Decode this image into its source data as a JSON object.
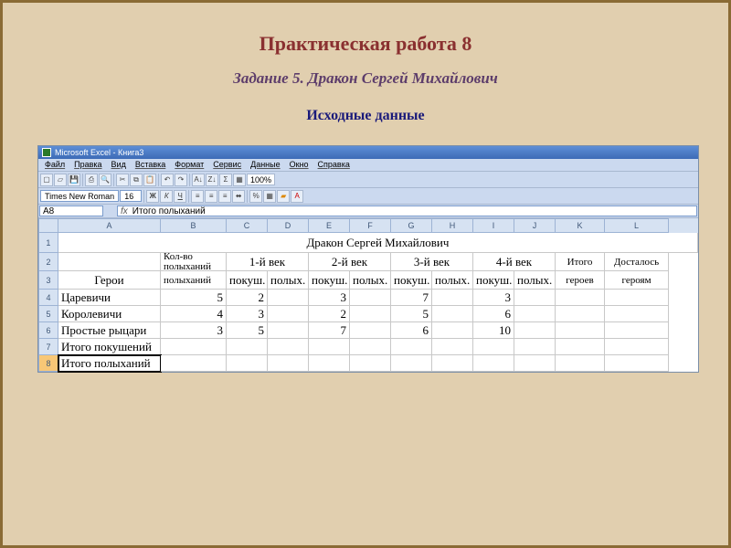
{
  "page": {
    "title_main": "Практическая работа 8",
    "title_task": "Задание 5. Дракон Сергей Михайлович",
    "title_data": "Исходные данные"
  },
  "excel": {
    "app_title": "Microsoft Excel - Книга3",
    "menus": [
      "Файл",
      "Правка",
      "Вид",
      "Вставка",
      "Формат",
      "Сервис",
      "Данные",
      "Окно",
      "Справка"
    ],
    "font_name": "Times New Roman",
    "font_size": "16",
    "zoom": "100%",
    "name_box": "A8",
    "formula": "Итого полыханий",
    "columns": [
      "A",
      "B",
      "C",
      "D",
      "E",
      "F",
      "G",
      "H",
      "I",
      "J",
      "K",
      "L"
    ]
  },
  "chart_data": {
    "type": "table",
    "title": "Дракон Сергей Михайлович",
    "column_groups": [
      {
        "key": "heroes",
        "label": "Герои"
      },
      {
        "key": "flames",
        "label": "Кол-во полыханий"
      },
      {
        "key": "c1",
        "label": "1-й век",
        "sub": [
          "покуш.",
          "полых."
        ]
      },
      {
        "key": "c2",
        "label": "2-й век",
        "sub": [
          "покуш.",
          "полых."
        ]
      },
      {
        "key": "c3",
        "label": "3-й век",
        "sub": [
          "покуш.",
          "полых."
        ]
      },
      {
        "key": "c4",
        "label": "4-й век",
        "sub": [
          "покуш.",
          "полых."
        ]
      },
      {
        "key": "total_heroes",
        "label": "Итого героев"
      },
      {
        "key": "got",
        "label": "Досталось героям"
      }
    ],
    "rows": [
      {
        "hero": "Царевичи",
        "flames": 5,
        "p": [
          2,
          null,
          3,
          null,
          7,
          null,
          3,
          null
        ]
      },
      {
        "hero": "Королевичи",
        "flames": 4,
        "p": [
          3,
          null,
          2,
          null,
          5,
          null,
          6,
          null
        ]
      },
      {
        "hero": "Простые рыцари",
        "flames": 3,
        "p": [
          5,
          null,
          7,
          null,
          6,
          null,
          10,
          null
        ]
      }
    ],
    "footer_rows": [
      "Итого покушений",
      "Итого полыханий"
    ]
  }
}
